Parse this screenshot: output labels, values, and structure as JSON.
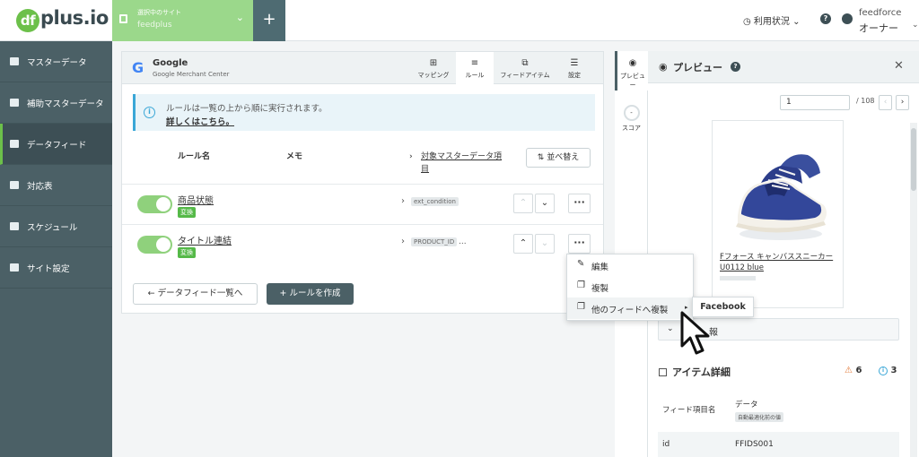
{
  "topbar": {
    "logo_mark": "df",
    "logo_text": "plus.io",
    "site_label": "選択中のサイト",
    "site_value": "feedplus",
    "usage_label": "利用状況",
    "user_org": "feedforce",
    "user_role": "オーナー"
  },
  "sidebar": {
    "items": [
      {
        "label": "マスターデータ"
      },
      {
        "label": "補助マスターデータ"
      },
      {
        "label": "データフィード"
      },
      {
        "label": "対応表"
      },
      {
        "label": "スケジュール"
      },
      {
        "label": "サイト設定"
      }
    ]
  },
  "feed": {
    "name": "Google",
    "subname": "Google Merchant Center",
    "tabs": [
      {
        "label": "マッピング",
        "icon": "mapping-icon"
      },
      {
        "label": "ルール",
        "icon": "rule-icon"
      },
      {
        "label": "フィードアイテム",
        "icon": "items-icon"
      },
      {
        "label": "設定",
        "icon": "settings-icon"
      }
    ],
    "info_text": "ルールは一覧の上から順に実行されます。",
    "info_link": "詳しくはこちら。",
    "col_rule": "ルール名",
    "col_memo": "メモ",
    "col_target": "対象マスターデータ項目",
    "sort_label": "並べ替え",
    "rules": [
      {
        "name": "商品状態",
        "badge": "変換",
        "target": "ext_condition",
        "more": ""
      },
      {
        "name": "タイトル連結",
        "badge": "変換",
        "target": "PRODUCT_ID",
        "more": "..."
      }
    ],
    "back_label": "データフィード一覧へ",
    "create_label": "ルールを作成"
  },
  "menu": {
    "items": [
      {
        "label": "編集"
      },
      {
        "label": "複製"
      },
      {
        "label": "他のフィードへ複製"
      }
    ],
    "submenu_label": "Facebook"
  },
  "preview": {
    "tab_preview": "プレビュー",
    "tab_score": "スコア",
    "score_value": "-",
    "title": "プレビュー",
    "page_value": "1",
    "page_total": "/ 108",
    "product_name": "Fフォース キャンバススニーカー U0112 blue",
    "info_bar_label": "報",
    "item_detail_title": "アイテム詳細",
    "warn_count": "6",
    "info_count": "3",
    "col_field": "フィード項目名",
    "col_data": "データ",
    "col_data_sub": "自動最適化前の値",
    "rows": [
      {
        "field": "id",
        "value": "FFIDS001"
      }
    ]
  }
}
